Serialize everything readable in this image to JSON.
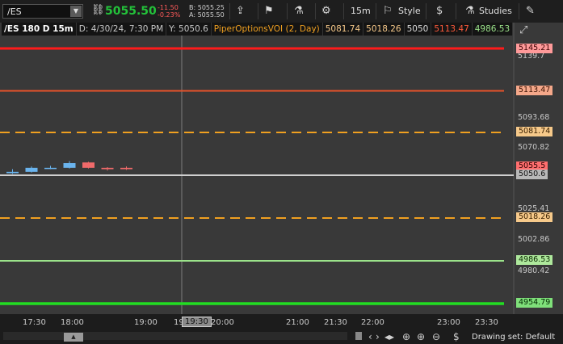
{
  "toolbar": {
    "symbol": "/ES",
    "last_price": "5055.50",
    "net_change": "-11.50",
    "pct_change": "-0.23%",
    "bid": "B: 5055.25",
    "ask": "A: 5055.50",
    "timeframe": "15m",
    "style_label": "Style",
    "studies_label": "Studies"
  },
  "info_bar": {
    "symbol_period": "/ES 180 D 15m",
    "date": "D: 4/30/24, 7:30 PM",
    "y_value": "Y: 5050.6",
    "study_name": "PiperOptionsVOI (2, Day)",
    "v1": "5081.74",
    "v2": "5018.26",
    "v3": "5050",
    "v4": "5113.47",
    "v5": "4986.53"
  },
  "price_axis": {
    "ticks": [
      "5139.7",
      "5093.68",
      "5070.82",
      "5025.41",
      "5002.86",
      "4980.42"
    ],
    "labels": {
      "l5145": "5145.21",
      "l5113": "5113.47",
      "l5081": "5081.74",
      "l5055": "5055.5",
      "l5050": "5050.6",
      "l5018": "5018.26",
      "l4986": "4986.53",
      "l4954": "4954.79"
    }
  },
  "time_axis": {
    "ticks": [
      "17:30",
      "18:00",
      "19:00",
      "19",
      "20:00",
      "21:00",
      "21:30",
      "22:00",
      "23:00",
      "23:30"
    ],
    "crosshair_time": "19:30"
  },
  "status": {
    "drawing_set": "Drawing set: Default"
  },
  "colors": {
    "red_line": "#ff1a1a",
    "orange_red_line": "#e8522a",
    "orange_dash": "#f0a020",
    "green_light": "#9be38a",
    "green_bright": "#22dd22",
    "up_candle": "#6ab4ee",
    "down_candle": "#f06a6a"
  },
  "chart_data": {
    "type": "candlestick",
    "levels": [
      5145.21,
      5113.47,
      5081.74,
      5050,
      5018.26,
      4986.53,
      4954.79
    ],
    "last_price": 5055.5,
    "crosshair": {
      "time": "19:30",
      "value": 5050.6
    },
    "candles": [
      {
        "open": 5051.5,
        "close": 5052.5,
        "high": 5054.5,
        "low": 5051.0
      },
      {
        "open": 5052.5,
        "close": 5055.5,
        "high": 5056.5,
        "low": 5052.0
      },
      {
        "open": 5055.0,
        "close": 5055.5,
        "high": 5057.0,
        "low": 5054.5
      },
      {
        "open": 5055.5,
        "close": 5059.0,
        "high": 5060.5,
        "low": 5055.0
      },
      {
        "open": 5059.5,
        "close": 5055.5,
        "high": 5060.0,
        "low": 5055.0
      },
      {
        "open": 5055.5,
        "close": 5054.5,
        "high": 5056.0,
        "low": 5053.5
      },
      {
        "open": 5055.5,
        "close": 5054.5,
        "high": 5056.5,
        "low": 5054.0
      }
    ]
  }
}
